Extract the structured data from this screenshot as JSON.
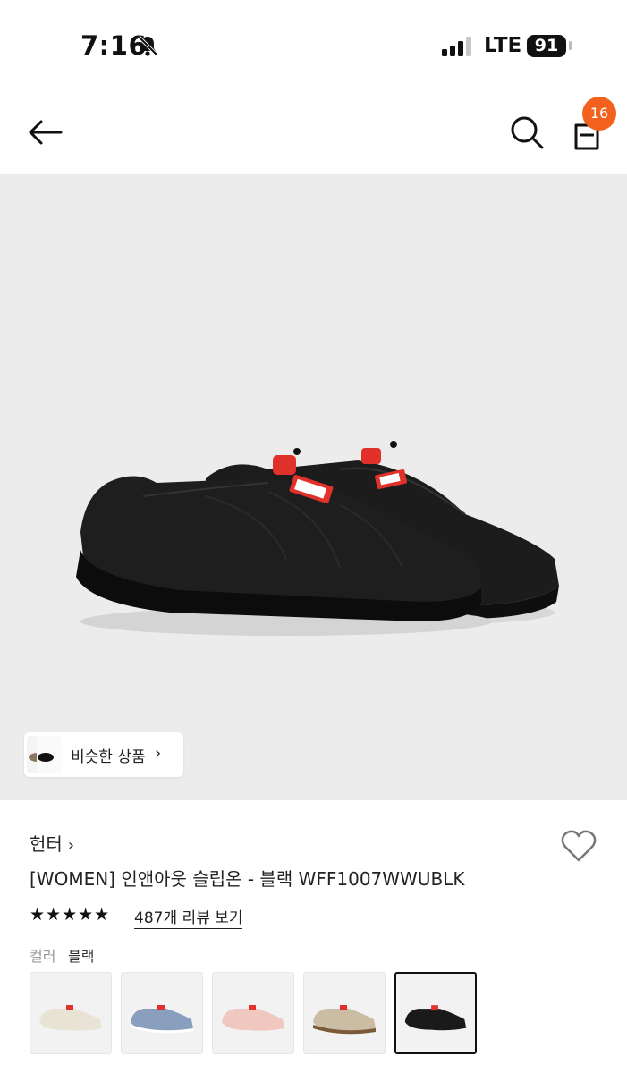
{
  "status_bar": {
    "time": "7:16",
    "network": "LTE",
    "battery": "91"
  },
  "nav": {
    "cart_count": "16"
  },
  "hero": {
    "similar_label": "비슷한 상품"
  },
  "product": {
    "brand": "헌터",
    "title": "[WOMEN] 인앤아웃 슬립온 - 블랙 WFF1007WWUBLK",
    "rating_stars": "★★★★★",
    "rating": 5,
    "reviews_label": "487개 리뷰 보기",
    "color_label": "컬러",
    "color_value": "블랙"
  },
  "swatches": [
    {
      "color": "#e9e3d6",
      "selected": false
    },
    {
      "color": "#8a9fbe",
      "selected": false
    },
    {
      "color": "#f0c8c0",
      "selected": false
    },
    {
      "color": "#cbbda3",
      "selected": false
    },
    {
      "color": "#1a1a1a",
      "selected": true
    }
  ],
  "colors": {
    "accent": "#f2611d",
    "hero_bg": "#ececec",
    "toggle_red": "#e0312b"
  }
}
